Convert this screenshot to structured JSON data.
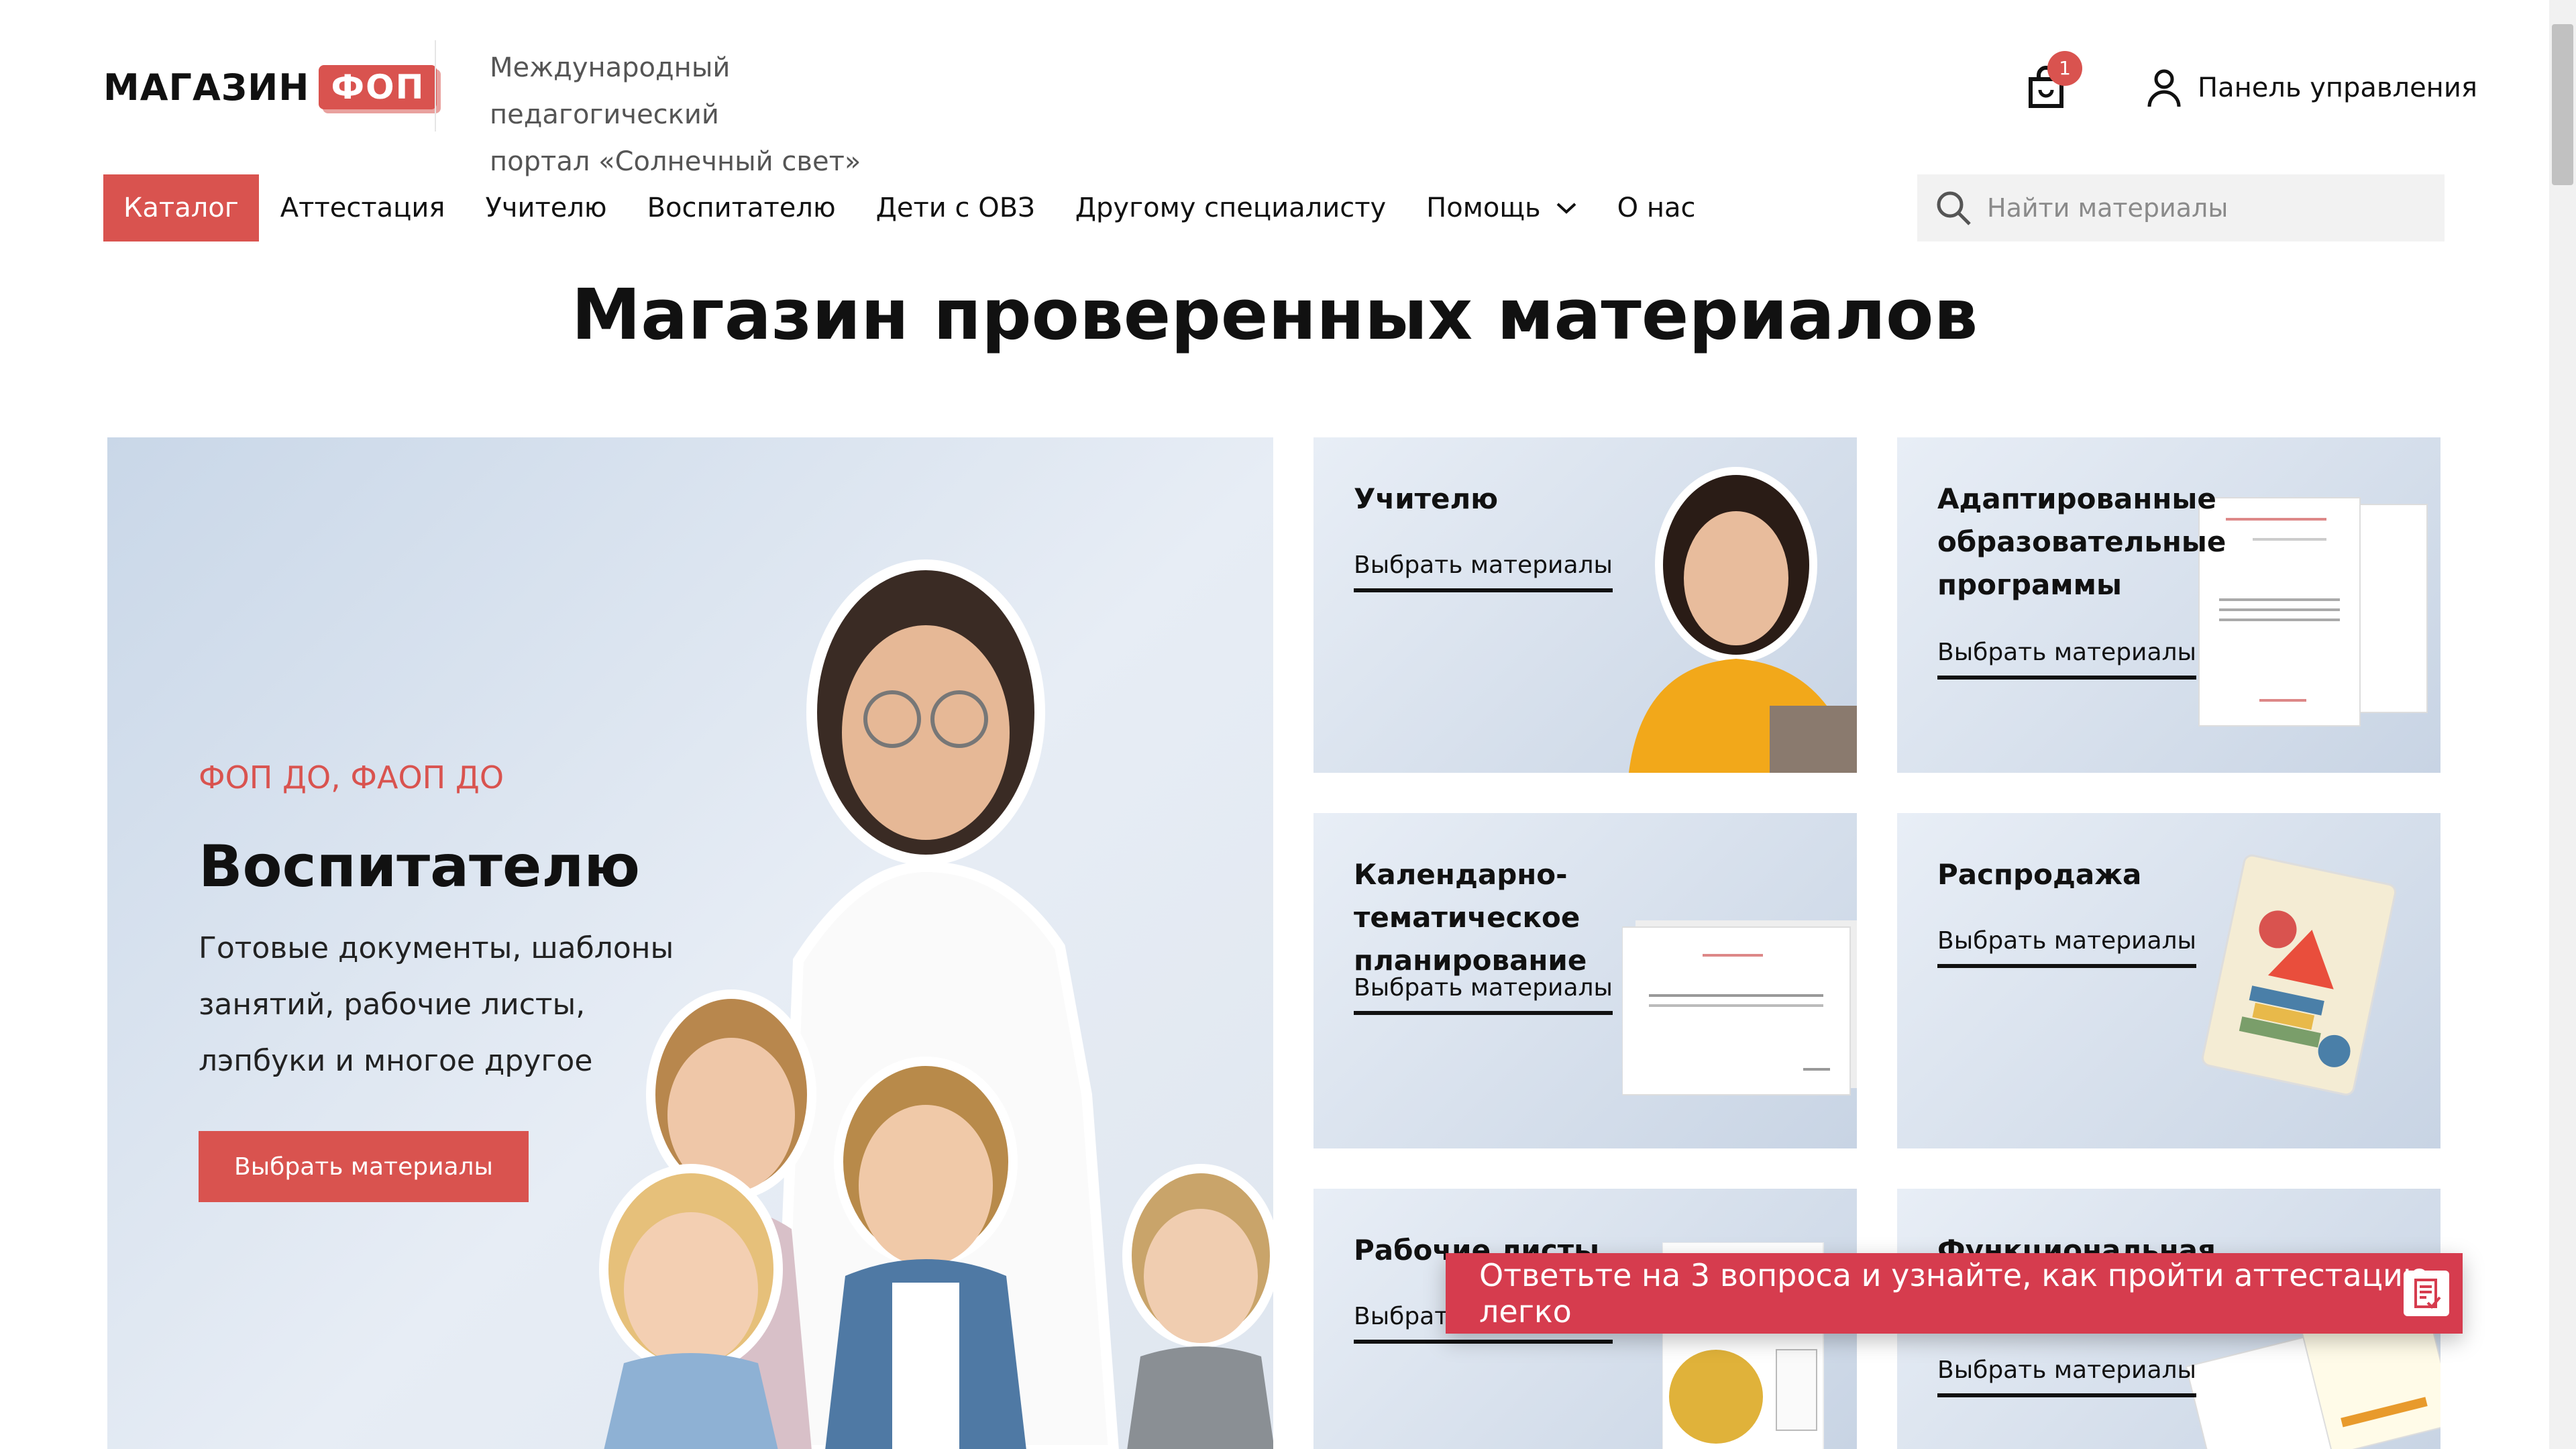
{
  "header": {
    "logo_word": "МАГАЗИН",
    "logo_badge": "ФОП",
    "tagline_line1": "Международный педагогический",
    "tagline_line2": "портал «Солнечный свет»",
    "cart_count": "1",
    "panel_label": "Панель управления"
  },
  "nav": {
    "items": [
      {
        "label": "Каталог",
        "active": true
      },
      {
        "label": "Аттестация"
      },
      {
        "label": "Учителю"
      },
      {
        "label": "Воспитателю"
      },
      {
        "label": "Дети с ОВЗ"
      },
      {
        "label": "Другому специалисту"
      },
      {
        "label": "Помощь",
        "dropdown": true
      },
      {
        "label": "О нас"
      }
    ],
    "search_placeholder": "Найти материалы"
  },
  "page": {
    "title": "Магазин проверенных материалов"
  },
  "hero": {
    "eyebrow": "ФОП ДО, ФАОП ДО",
    "title": "Воспитателю",
    "description": "Готовые документы, шаблоны занятий, рабочие листы, лэпбуки и многое другое",
    "button": "Выбрать материалы"
  },
  "cards": [
    {
      "title": "Учителю",
      "link": "Выбрать материалы"
    },
    {
      "title": "Адаптированные образовательные программы",
      "link": "Выбрать материалы"
    },
    {
      "title": "Календарно-тематическое планирование",
      "link": "Выбрать материалы"
    },
    {
      "title": "Распродажа",
      "link": "Выбрать материалы"
    },
    {
      "title": "Рабочие листы",
      "link": "Выбрать материалы"
    },
    {
      "title": "Функциональная",
      "link": "Выбрать материалы"
    }
  ],
  "toast": {
    "text": "Ответьте на 3 вопроса и узнайте, как пройти аттестацию легко"
  },
  "colors": {
    "accent": "#d9534f",
    "toast": "#d63c4e",
    "card_bg": "#d6e0ec"
  }
}
